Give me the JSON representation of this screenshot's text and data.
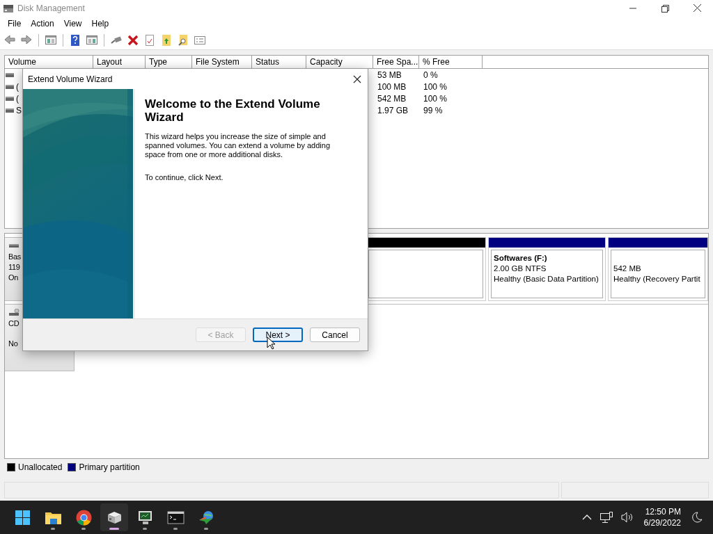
{
  "window": {
    "title": "Disk Management"
  },
  "menu": [
    {
      "label": "File"
    },
    {
      "label": "Action"
    },
    {
      "label": "View"
    },
    {
      "label": "Help"
    }
  ],
  "volume_table": {
    "columns": [
      "Volume",
      "Layout",
      "Type",
      "File System",
      "Status",
      "Capacity",
      "Free Spa...",
      "% Free"
    ],
    "rows": [
      {
        "free_space": "53 MB",
        "percent_free": "0 %"
      },
      {
        "volume": "(",
        "free_space": "100 MB",
        "percent_free": "100 %"
      },
      {
        "volume": "(",
        "free_space": "542 MB",
        "percent_free": "100 %"
      },
      {
        "volume": "S",
        "free_space": "1.97 GB",
        "percent_free": "99 %"
      }
    ]
  },
  "disks": [
    {
      "kind": "disk",
      "label_lines": [
        "Bas",
        "119",
        "On"
      ],
      "partitions": [
        {
          "kind": "unallocated"
        },
        {
          "kind": "primary",
          "name": "Softwares  (F:)",
          "lines": [
            "2.00 GB NTFS",
            "Healthy (Basic Data Partition)"
          ]
        },
        {
          "kind": "primary",
          "lines": [
            "542 MB",
            "Healthy (Recovery Partit"
          ]
        }
      ]
    },
    {
      "kind": "cdrom",
      "label_lines": [
        "CD",
        "No"
      ]
    }
  ],
  "legend": [
    {
      "label": "Unallocated",
      "color": "#000000"
    },
    {
      "label": "Primary partition",
      "color": "#000080"
    }
  ],
  "dialog": {
    "title": "Extend Volume Wizard",
    "heading": "Welcome to the Extend Volume Wizard",
    "body": "This wizard helps you increase the size of simple and spanned volumes. You can extend a volume  by adding space from one or more additional disks.",
    "hint": "To continue, click Next.",
    "buttons": [
      {
        "label": "< Back",
        "disabled": true,
        "focused": false
      },
      {
        "label": "Next >",
        "disabled": false,
        "focused": true
      },
      {
        "label": "Cancel",
        "disabled": false,
        "focused": false
      }
    ]
  },
  "taskbar": {
    "apps": [
      {
        "kind": "start",
        "selected": false,
        "running": false
      },
      {
        "kind": "folder",
        "selected": false,
        "running": true
      },
      {
        "kind": "browser",
        "selected": false,
        "running": true
      },
      {
        "kind": "disk",
        "selected": true,
        "running": true
      },
      {
        "kind": "monitor",
        "selected": false,
        "running": true
      },
      {
        "kind": "terminal",
        "selected": false,
        "running": true
      },
      {
        "kind": "globe",
        "selected": false,
        "running": true
      }
    ],
    "time": "12:50 PM",
    "date": "6/29/2022"
  }
}
